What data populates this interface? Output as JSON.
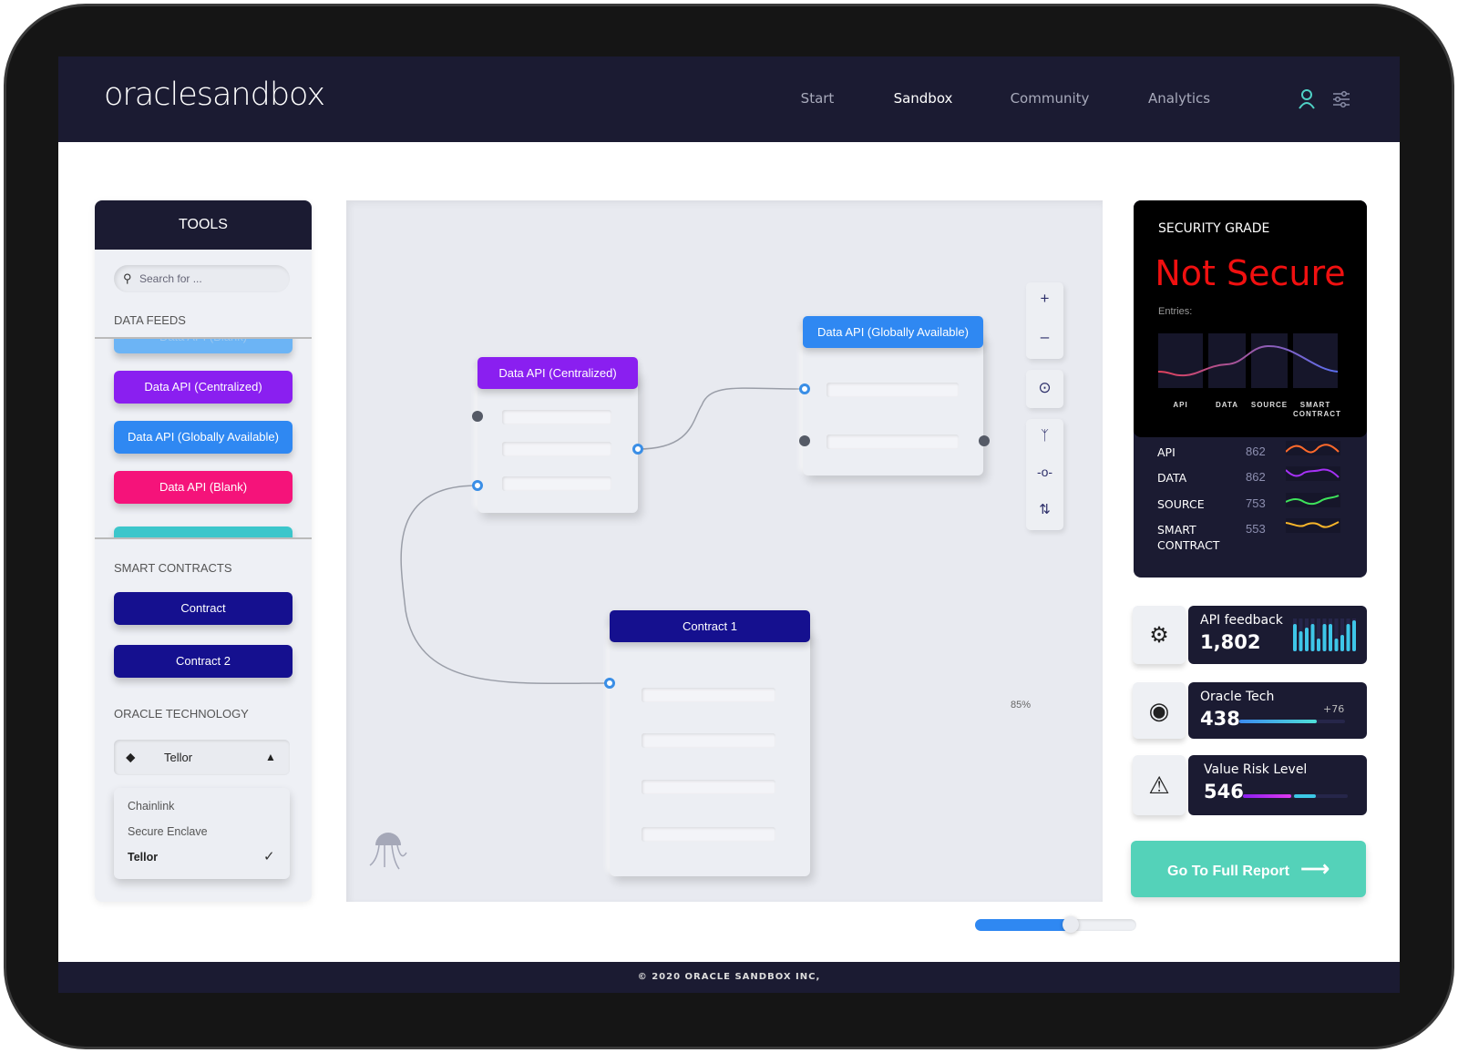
{
  "header": {
    "logo": "oraclesandbox",
    "nav": [
      {
        "label": "Start"
      },
      {
        "label": "Sandbox",
        "active": true
      },
      {
        "label": "Community"
      },
      {
        "label": "Analytics"
      }
    ],
    "icons": [
      "user-icon",
      "sliders-icon"
    ]
  },
  "tools": {
    "title": "TOOLS",
    "search_placeholder": "Search for ...",
    "data_feeds_label": "DATA FEEDS",
    "data_feeds": [
      {
        "label": "Data API (Blank)",
        "color": "#6cb4f5"
      },
      {
        "label": "Data API (Centralized)",
        "color": "#8a1ff0"
      },
      {
        "label": "Data API (Globally Available)",
        "color": "#2f88f2"
      },
      {
        "label": "Data API (Blank)",
        "color": "#f5137a"
      },
      {
        "label": "",
        "color": "#3cc6cb"
      }
    ],
    "smart_contracts_label": "SMART CONTRACTS",
    "smart_contracts": [
      {
        "label": "Contract"
      },
      {
        "label": "Contract 2"
      }
    ],
    "oracle_label": "ORACLE TECHNOLOGY",
    "oracle_selected": "Tellor",
    "oracle_options": [
      {
        "label": "Chainlink"
      },
      {
        "label": "Secure Enclave"
      },
      {
        "label": "Tellor",
        "selected": true
      }
    ]
  },
  "canvas": {
    "nodes": [
      {
        "title": "Data API (Centralized)",
        "color": "#8a1ff0"
      },
      {
        "title": "Data API (Globally Available)",
        "color": "#2f88f2"
      },
      {
        "title": "Contract 1",
        "color": "#15108f"
      }
    ],
    "zoom_label": "85%",
    "zoom_value": 0.85
  },
  "security": {
    "title": "SECURITY GRADE",
    "grade": "Not Secure",
    "entries_label": "Entries:",
    "chart_labels": [
      "API",
      "DATA",
      "SOURCE",
      "SMART CONTRACT"
    ],
    "rows": [
      {
        "label": "API",
        "value": "862",
        "color": "#ff6a2b"
      },
      {
        "label": "DATA",
        "value": "862",
        "color": "#a531f5"
      },
      {
        "label": "SOURCE",
        "value": "753",
        "color": "#3ee35b"
      },
      {
        "label": "SMART CONTRACT",
        "value": "553",
        "color": "#f7b52a"
      }
    ]
  },
  "stats": [
    {
      "title": "API feedback",
      "value": "1,802",
      "icon": "gear-api-icon"
    },
    {
      "title": "Oracle Tech",
      "value": "438",
      "delta": "+76",
      "icon": "eye-icon"
    },
    {
      "title": "Value Risk Level",
      "value": "546",
      "icon": "warning-icon"
    }
  ],
  "report_button": "Go To Full Report",
  "footer": "© 2020 ORACLE SANDBOX INC,"
}
